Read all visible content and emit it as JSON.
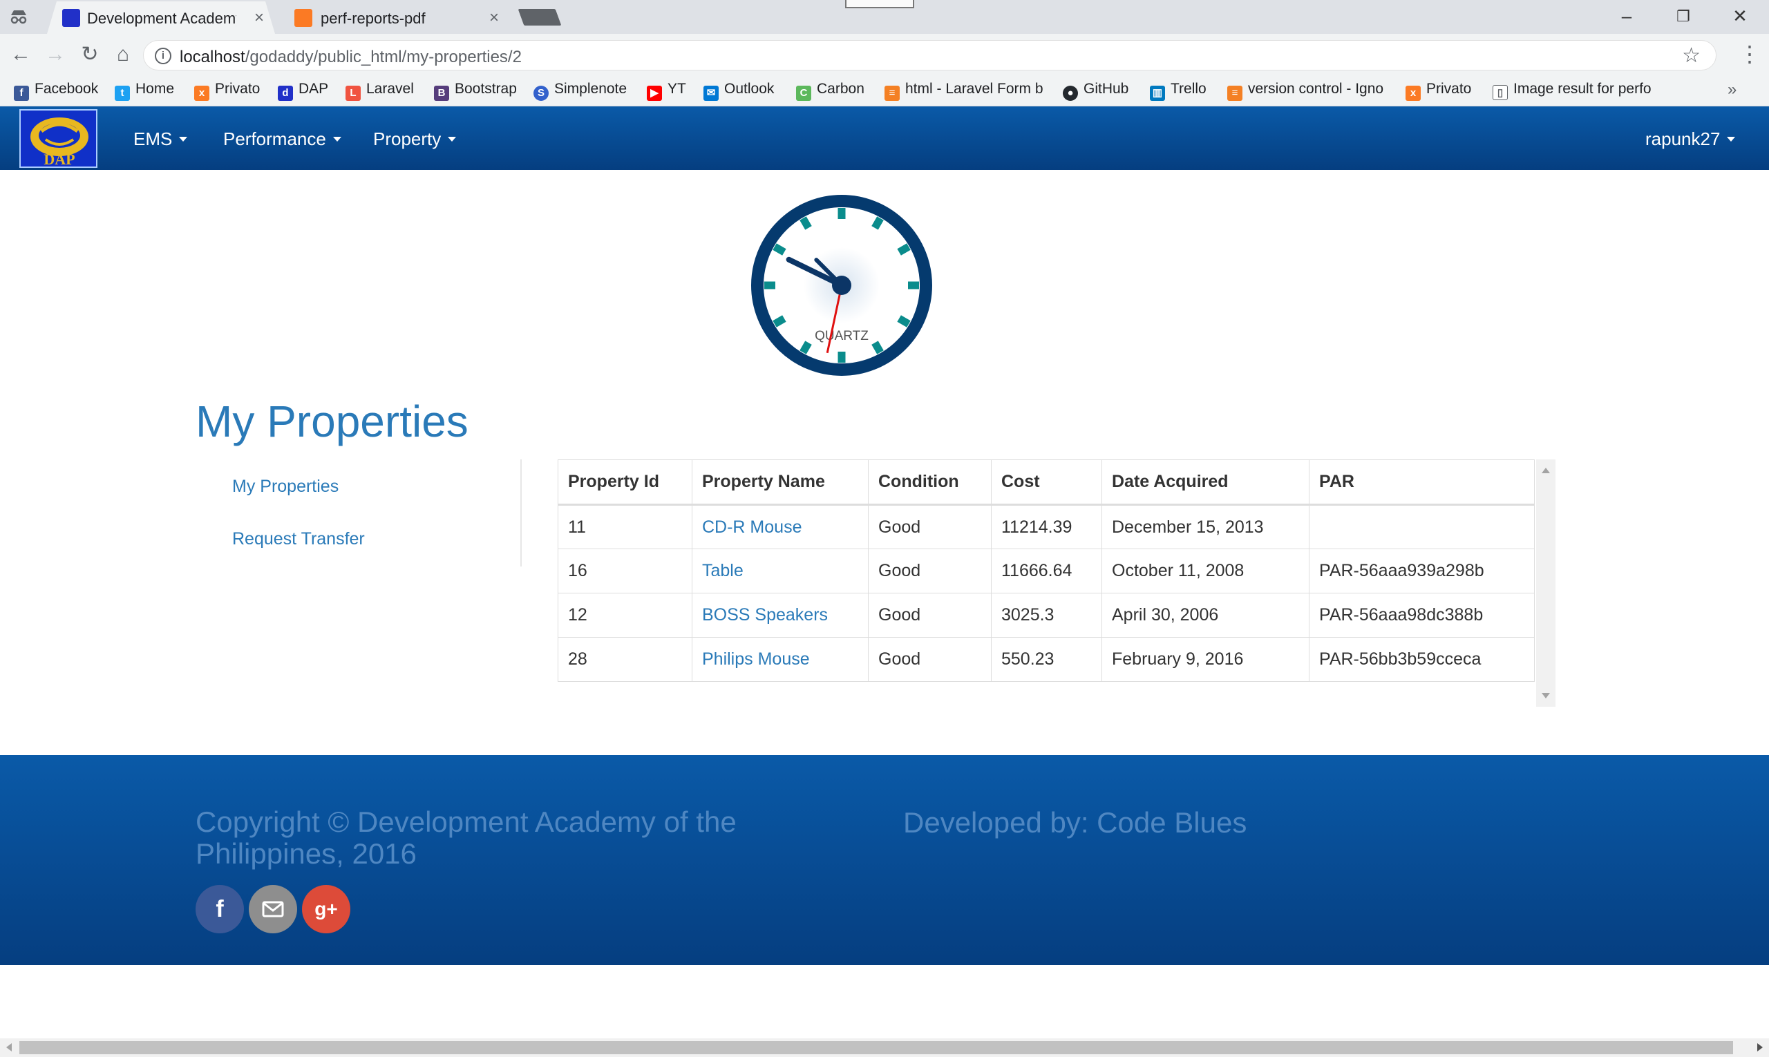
{
  "browser": {
    "tabs": [
      {
        "title": "Development Academy c",
        "active": true
      },
      {
        "title": "perf-reports-pdf",
        "active": false
      }
    ],
    "url_host": "localhost",
    "url_path": "/godaddy/public_html/my-properties/2",
    "bookmarks": [
      "Facebook",
      "Home",
      "Privato",
      "DAP",
      "Laravel",
      "Bootstrap",
      "Simplenote",
      "YT",
      "Outlook",
      "Carbon",
      "html - Laravel Form b",
      "GitHub",
      "Trello",
      "version control - Igno",
      "Privato",
      "Image result for perfo"
    ],
    "more_bookmarks": "»"
  },
  "nav": {
    "logo_text": "DAP",
    "items": [
      "EMS",
      "Performance",
      "Property"
    ],
    "user": "rapunk27"
  },
  "clock": {
    "label": "QUARTZ",
    "hours": 9,
    "minutes": 52,
    "seconds": 32,
    "colors": {
      "rim": "#053a6e",
      "marker": "#0a8c8c",
      "hands": "#0b3566",
      "second_hand": "#e01010"
    }
  },
  "page": {
    "title": "My Properties",
    "sidebar": [
      "My Properties",
      "Request Transfer"
    ]
  },
  "table": {
    "headers": [
      "Property Id",
      "Property Name",
      "Condition",
      "Cost",
      "Date Acquired",
      "PAR"
    ],
    "rows": [
      [
        "11",
        "CD-R Mouse",
        "Good",
        "11214.39",
        "December 15, 2013",
        ""
      ],
      [
        "16",
        "Table",
        "Good",
        "11666.64",
        "October 11, 2008",
        "PAR-56aaa939a298b"
      ],
      [
        "12",
        "BOSS Speakers",
        "Good",
        "3025.3",
        "April 30, 2006",
        "PAR-56aaa98dc388b"
      ],
      [
        "28",
        "Philips Mouse",
        "Good",
        "550.23",
        "February 9, 2016",
        "PAR-56bb3b59cceca"
      ]
    ]
  },
  "footer": {
    "copyright": "Copyright © Development Academy of the Philippines, 2016",
    "developed_by": "Developed by: Code Blues",
    "social": [
      "facebook-icon",
      "mail-icon",
      "google-plus-icon"
    ]
  },
  "colors": {
    "brand_blue": "#0a5aa8",
    "link_blue": "#2a7ab8",
    "footer_text": "#4f87c2",
    "facebook": "#3b5998",
    "mail": "#8e8e8e",
    "google_plus": "#dd4b39"
  }
}
